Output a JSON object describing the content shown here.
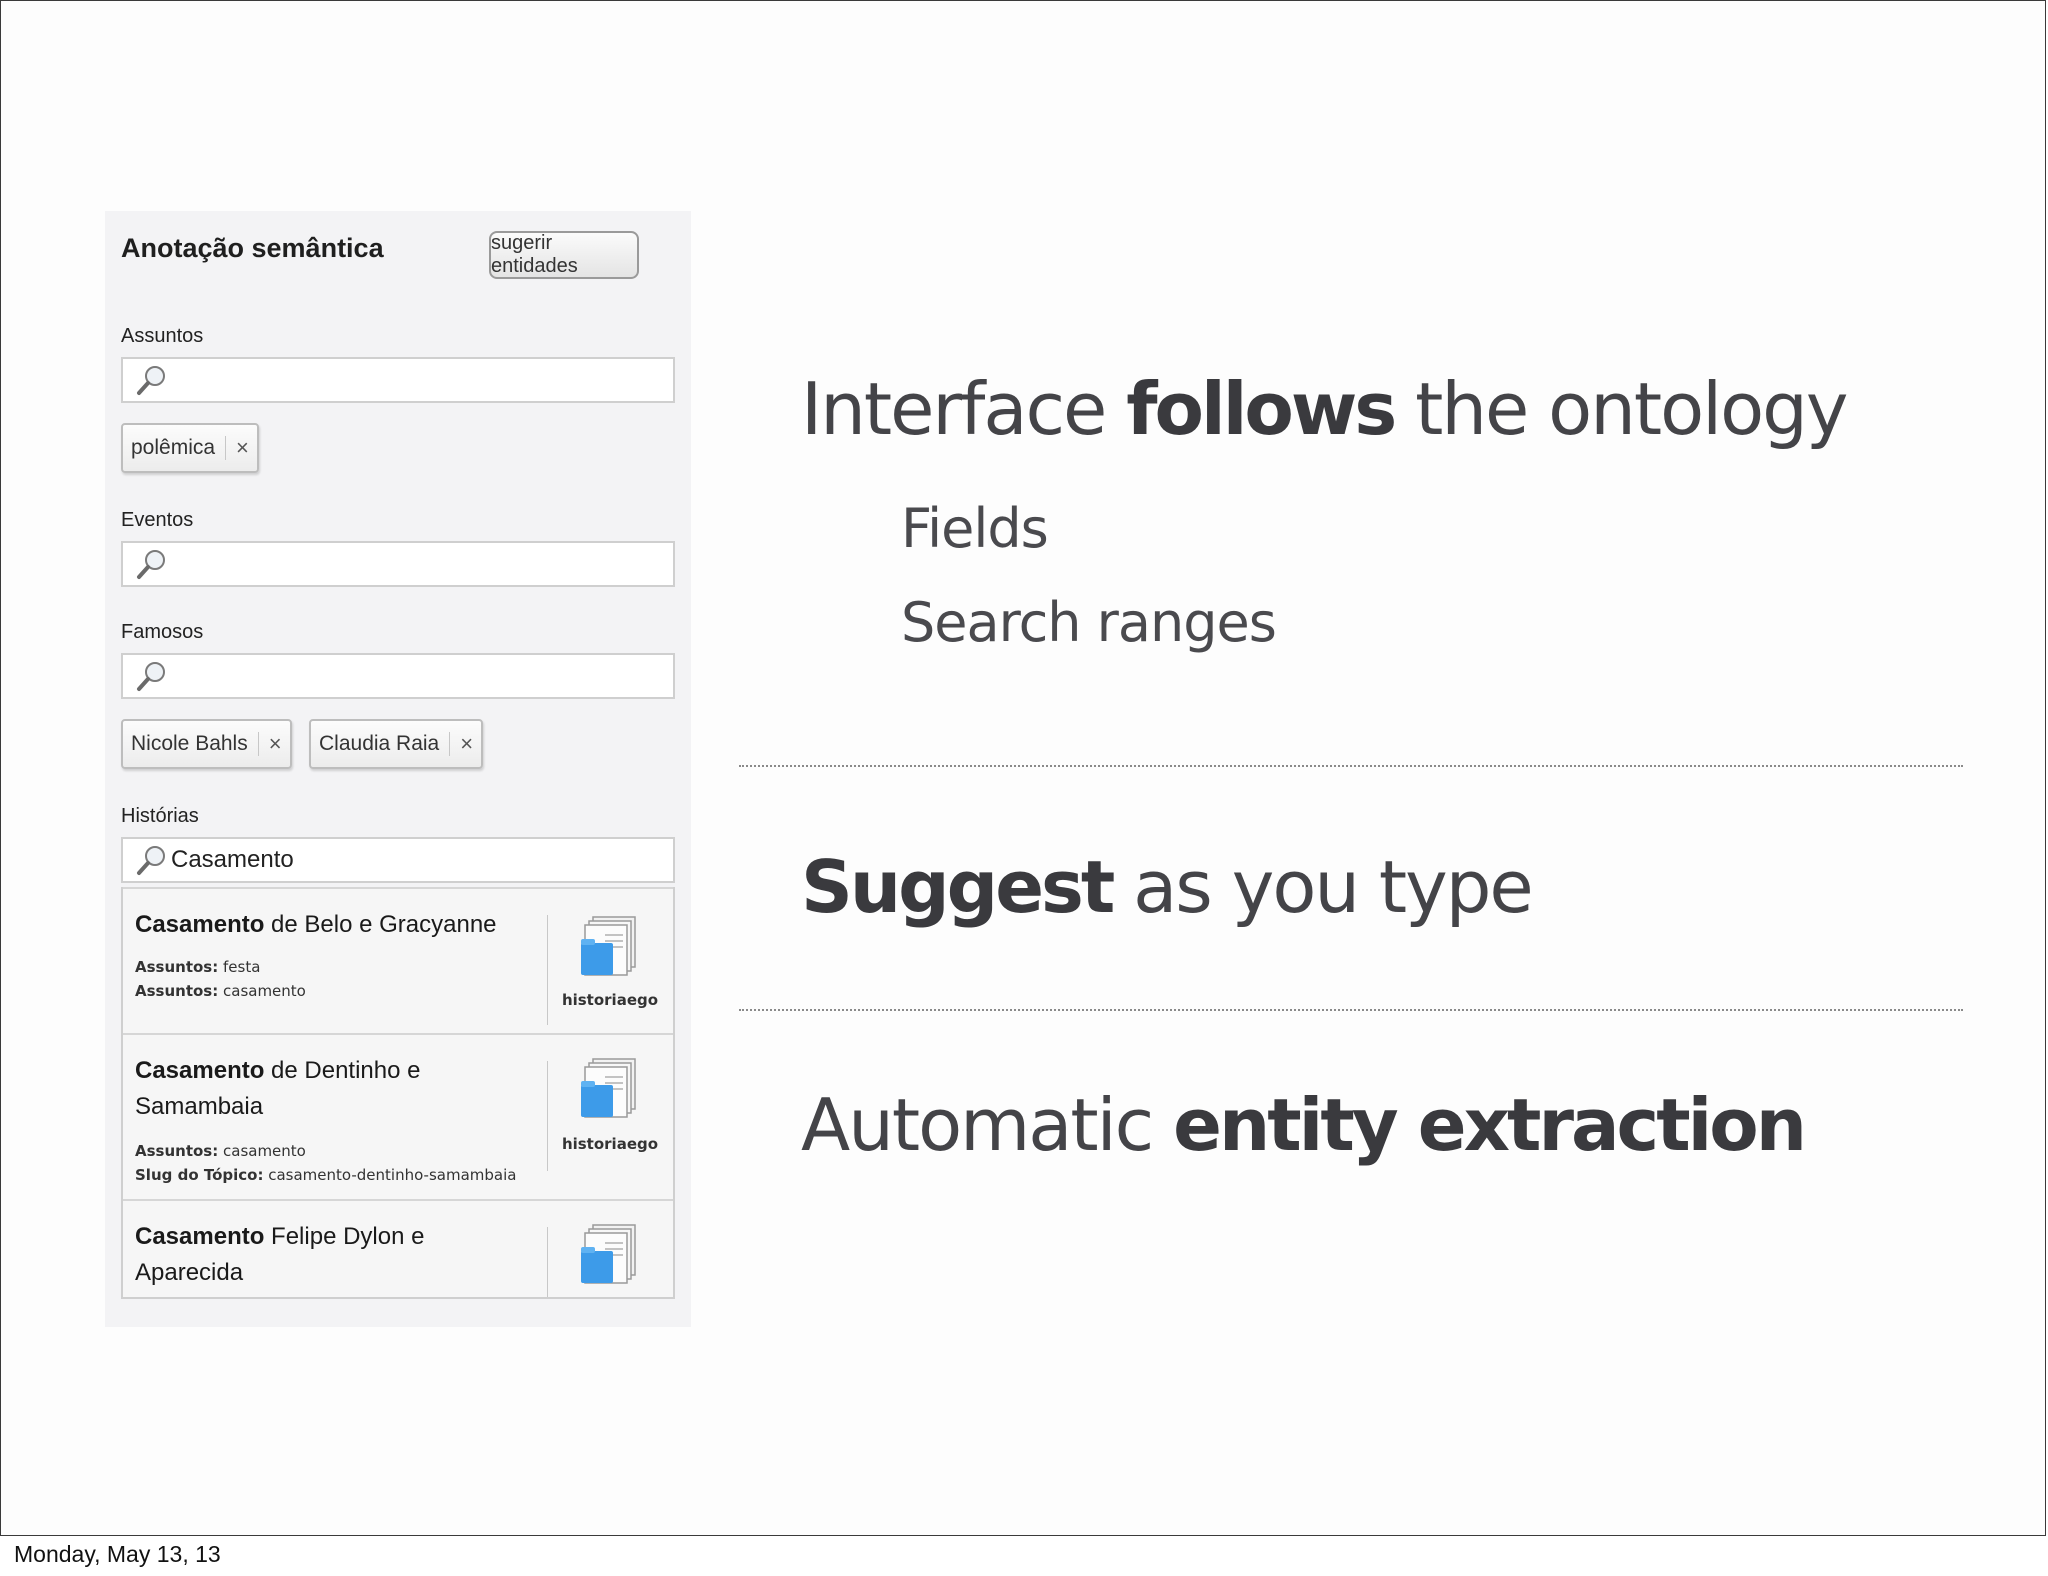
{
  "panel": {
    "title": "Anotação semântica",
    "suggest_button": "sugerir entidades",
    "fields": [
      {
        "label": "Assuntos",
        "value": "",
        "tags": [
          "polêmica"
        ]
      },
      {
        "label": "Eventos",
        "value": "",
        "tags": []
      },
      {
        "label": "Famosos",
        "value": "",
        "tags": [
          "Nicole Bahls",
          "Claudia Raia"
        ]
      },
      {
        "label": "Histórias",
        "value": "Casamento",
        "tags": []
      }
    ],
    "tag_remove": "×",
    "results": [
      {
        "title_bold": "Casamento",
        "title_rest": " de Belo e Gracyanne",
        "meta": [
          {
            "key": "Assuntos:",
            "value": " festa"
          },
          {
            "key": "Assuntos:",
            "value": " casamento"
          }
        ],
        "source": "historiaego"
      },
      {
        "title_bold": "Casamento",
        "title_rest": " de Dentinho e Samambaia",
        "meta": [
          {
            "key": "Assuntos:",
            "value": " casamento"
          },
          {
            "key": "Slug do Tópico:",
            "value": " casamento-dentinho-samambaia"
          }
        ],
        "source": "historiaego"
      },
      {
        "title_bold": "Casamento",
        "title_rest": " Felipe Dylon e Aparecida",
        "meta": [],
        "source": ""
      }
    ]
  },
  "slide": {
    "point1": {
      "pre": "Interface ",
      "bold": "follows",
      "post": " the ontology"
    },
    "sub1": "Fields",
    "sub2": "Search ranges",
    "point2": {
      "pre": "",
      "bold": "Suggest",
      "post": " as you type"
    },
    "point3": {
      "pre": "Automatic ",
      "bold": "entity extraction",
      "post": ""
    }
  },
  "footer": {
    "date": "Monday, May 13, 13"
  }
}
